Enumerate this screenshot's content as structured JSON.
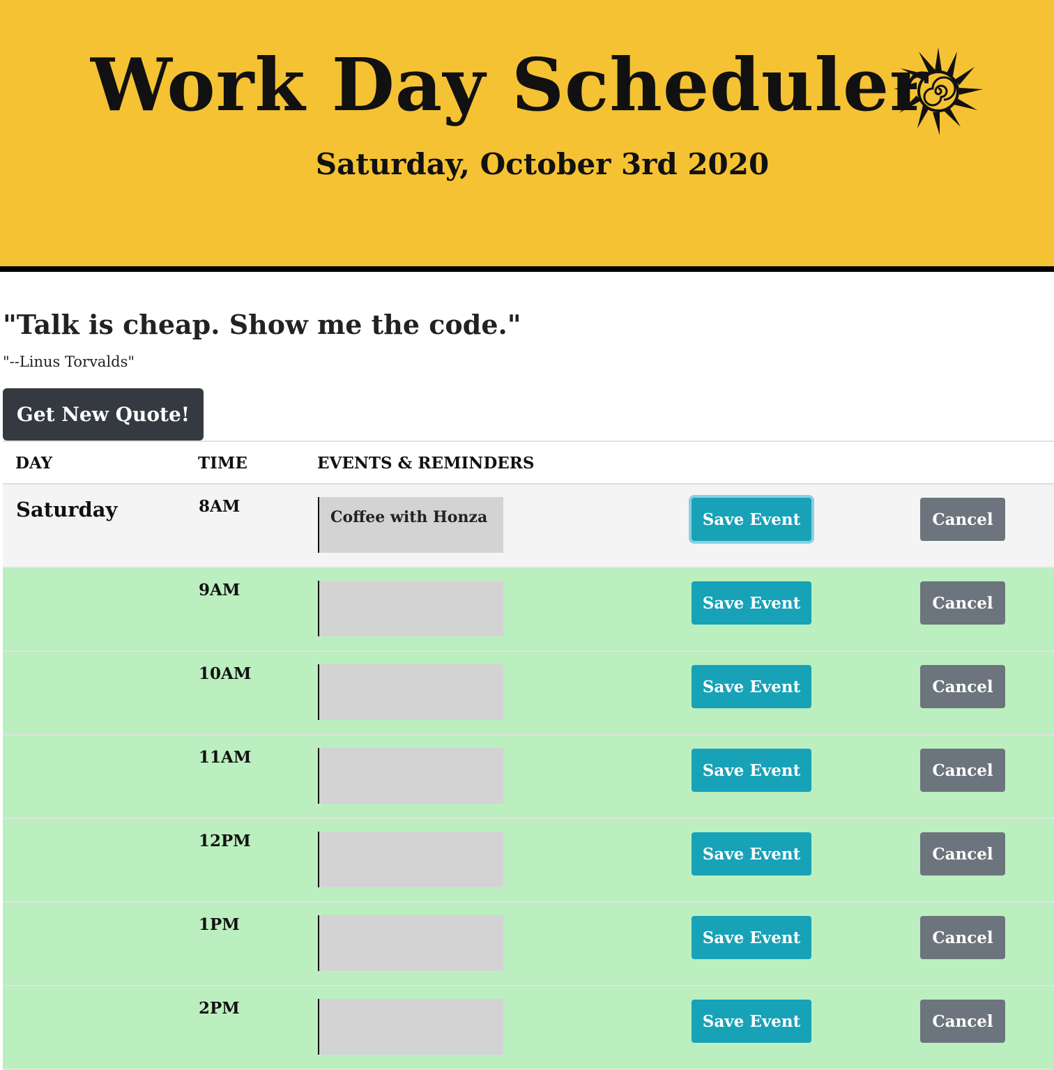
{
  "header": {
    "title": "Work Day Scheduler",
    "date": "Saturday, October 3rd 2020",
    "icon": "sun-icon",
    "background_color": "#f5c234"
  },
  "quote": {
    "text": "\"Talk is cheap. Show me the code.\"",
    "author": "\"--Linus Torvalds\"",
    "button_label": "Get New Quote!"
  },
  "table": {
    "headers": {
      "day": "DAY",
      "time": "TIME",
      "events": "EVENTS & REMINDERS"
    },
    "day_label": "Saturday",
    "save_label": "Save Event",
    "cancel_label": "Cancel",
    "colors": {
      "past": "#f4f4f4",
      "future": "#bbefbf",
      "save_button": "#17a2b8",
      "cancel_button": "#6c757d"
    },
    "rows": [
      {
        "time": "8AM",
        "event": "Coffee with Honza",
        "status": "past"
      },
      {
        "time": "9AM",
        "event": "",
        "status": "future"
      },
      {
        "time": "10AM",
        "event": "",
        "status": "future"
      },
      {
        "time": "11AM",
        "event": "",
        "status": "future"
      },
      {
        "time": "12PM",
        "event": "",
        "status": "future"
      },
      {
        "time": "1PM",
        "event": "",
        "status": "future"
      },
      {
        "time": "2PM",
        "event": "",
        "status": "future"
      }
    ]
  }
}
